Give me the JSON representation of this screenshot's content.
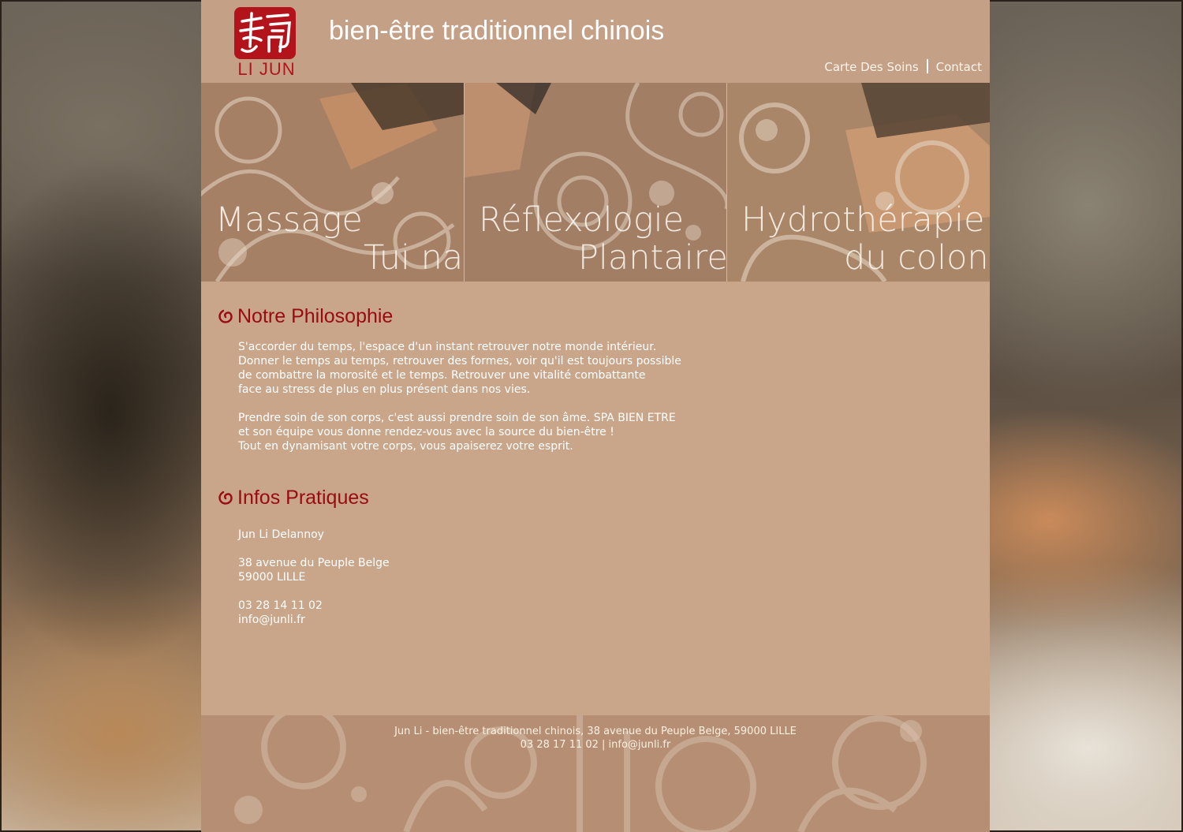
{
  "header": {
    "logo_text": "LI JUN",
    "site_title": "bien-être traditionnel chinois",
    "nav": [
      {
        "label": "Carte Des Soins"
      },
      {
        "label": "Contact"
      }
    ]
  },
  "banner": {
    "panels": [
      {
        "line1": "Massage",
        "line2": "Tui na"
      },
      {
        "line1": "Réflexologie",
        "line2": "Plantaire"
      },
      {
        "line1": "Hydrothérapie",
        "line2": "du colon"
      }
    ]
  },
  "philosophy": {
    "title": "Notre Philosophie",
    "lines": [
      "S'accorder du temps,  l'espace d'un instant retrouver notre monde intérieur.",
      "Donner le temps au temps, retrouver des formes, voir qu'il est toujours possible",
      "de combattre la morosité et le temps. Retrouver une vitalité combattante",
      "face au stress de plus en plus présent dans nos vies.",
      "",
      "Prendre soin de son corps, c'est aussi prendre soin de son âme. SPA BIEN ETRE",
      "et son équipe vous donne rendez-vous avec la source du bien-être !",
      "Tout en dynamisant votre corps, vous apaiserez votre esprit."
    ]
  },
  "infos": {
    "title": "Infos Pratiques",
    "name": "Jun Li Delannoy",
    "address_line1": "38 avenue du Peuple Belge",
    "address_line2": "59000 LILLE",
    "phone": "03 28 14 11 02",
    "email": "info@junli.fr"
  },
  "footer": {
    "line1": "Jun Li - bien-être traditionnel chinois,  38 avenue du Peuple Belge, 59000 LILLE",
    "line2": "03 28 17 11 02 | info@junli.fr"
  },
  "colors": {
    "accent_red": "#9a0a10",
    "seal_red": "#b3141c",
    "page_bg": "#c9a58a"
  }
}
